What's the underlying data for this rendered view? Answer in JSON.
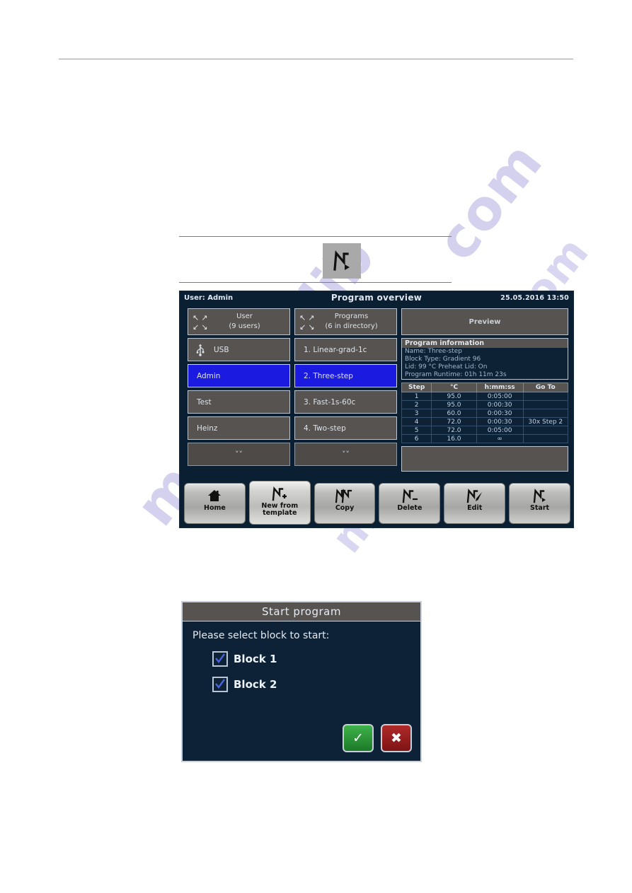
{
  "figure": {
    "icon_name": "start-program-icon"
  },
  "screen": {
    "user_label": "User: Admin",
    "title": "Program overview",
    "datetime": "25.05.2016  13:50",
    "user_column": {
      "header_title": "User",
      "header_count": "(9 users)",
      "items": [
        {
          "label": "USB",
          "icon": "usb-icon",
          "selected": false
        },
        {
          "label": "Admin",
          "icon": "",
          "selected": true
        },
        {
          "label": "Test",
          "icon": "",
          "selected": false
        },
        {
          "label": "Heinz",
          "icon": "",
          "selected": false
        }
      ],
      "scroll_label": "˅˅"
    },
    "programs_column": {
      "header_title": "Programs",
      "header_count": "(6 in directory)",
      "items": [
        {
          "label": "1. Linear-grad-1c",
          "selected": false
        },
        {
          "label": "2. Three-step",
          "selected": true
        },
        {
          "label": "3. Fast-1s-60c",
          "selected": false
        },
        {
          "label": "4. Two-step",
          "selected": false
        }
      ],
      "scroll_label": "˅˅"
    },
    "preview_label": "Preview",
    "program_information": {
      "header": "Program information",
      "lines": [
        "Name: Three-step",
        "Block Type: Gradient 96",
        "Lid: 99 °C  Preheat Lid: On",
        "Program Runtime: 01h 11m 23s"
      ]
    },
    "steps_table": {
      "columns": [
        "Step",
        "°C",
        "h:mm:ss",
        "Go To"
      ],
      "rows": [
        [
          "1",
          "95.0",
          "0:05:00",
          ""
        ],
        [
          "2",
          "95.0",
          "0:00:30",
          ""
        ],
        [
          "3",
          "60.0",
          "0:00:30",
          ""
        ],
        [
          "4",
          "72.0",
          "0:00:30",
          "30x Step 2"
        ],
        [
          "5",
          "72.0",
          "0:05:00",
          ""
        ],
        [
          "6",
          "16.0",
          "∞",
          ""
        ]
      ]
    },
    "toolbar": [
      {
        "label": "Home",
        "icon": "home-icon",
        "raised": false
      },
      {
        "label": "New from\ntemplate",
        "icon": "new-from-template-icon",
        "raised": true
      },
      {
        "label": "Copy",
        "icon": "copy-icon",
        "raised": false
      },
      {
        "label": "Delete",
        "icon": "delete-icon",
        "raised": false
      },
      {
        "label": "Edit",
        "icon": "edit-icon",
        "raised": false
      },
      {
        "label": "Start",
        "icon": "start-icon",
        "raised": false
      }
    ]
  },
  "dialog": {
    "title": "Start program",
    "prompt": "Please select block to start:",
    "checkboxes": [
      {
        "label": "Block 1",
        "checked": true
      },
      {
        "label": "Block 2",
        "checked": true
      }
    ],
    "ok_label": "✓",
    "cancel_label": "✖"
  },
  "watermark": {
    "text_1": "com",
    "text_2": "manualslib",
    "text_3": "manualslib.com"
  },
  "colors": {
    "screen_bg": "#0b1f33",
    "panel_gray": "#565350",
    "selected_blue": "#1b1ae0",
    "panel_border": "#b9c4d2",
    "table_text": "#bcd2e6",
    "ok_green": "#2e9c3a",
    "cancel_red": "#9c1f1f"
  }
}
